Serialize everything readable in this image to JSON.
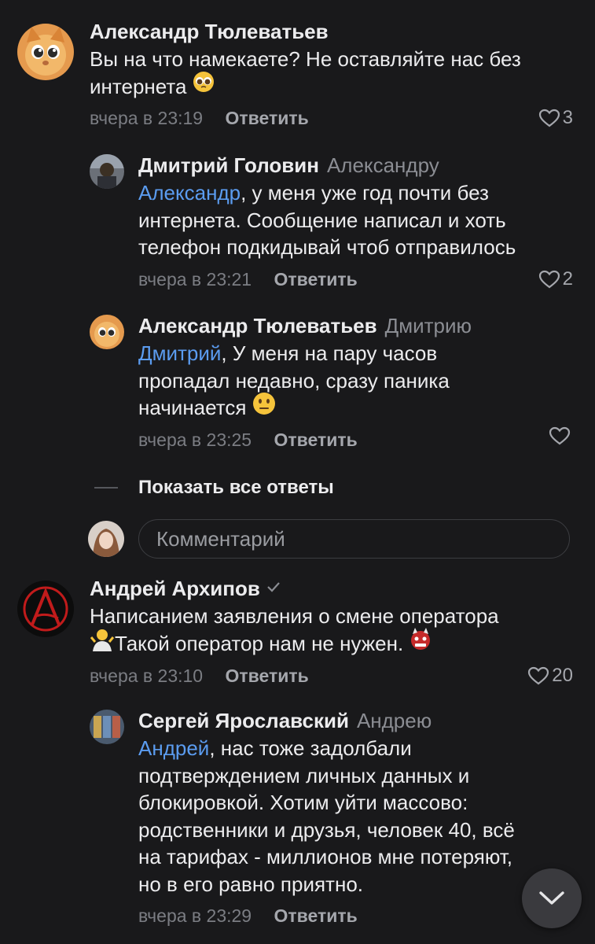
{
  "comments": [
    {
      "author": "Александр Тюлеватьев",
      "reply_to": "",
      "mention": "",
      "lines": [
        "Вы на что намекаете? Не оставляйте нас без",
        "интернета"
      ],
      "emoji": "pleading-face",
      "time": "вчера в 23:19",
      "reply_label": "Ответить",
      "likes": "3"
    },
    {
      "author": "Дмитрий Головин",
      "reply_to": "Александру",
      "mention": "Александр",
      "lines": [
        ", у меня уже год почти без",
        "интернета. Сообщение написал и хоть",
        "телефон подкидывай чтоб отправилось"
      ],
      "time": "вчера в 23:21",
      "reply_label": "Ответить",
      "likes": "2"
    },
    {
      "author": "Александр Тюлеватьев",
      "reply_to": "Дмитрию",
      "mention": "Дмитрий",
      "lines": [
        ", У меня на пару часов",
        "пропадал недавно, сразу паника",
        "начинается"
      ],
      "emoji": "neutral-face",
      "time": "вчера в 23:25",
      "reply_label": "Ответить",
      "likes": ""
    },
    {
      "author": "Андрей Архипов",
      "reply_to": "",
      "mention": "",
      "verified": true,
      "lines": [
        "Написанием заявления о смене оператора",
        "Такой оператор нам не нужен."
      ],
      "emoji": "ogre",
      "emoji_start": "person-shrugging",
      "time": "вчера в 23:10",
      "reply_label": "Ответить",
      "likes": "20"
    },
    {
      "author": "Сергей Ярославский",
      "reply_to": "Андрею",
      "mention": "Андрей",
      "lines": [
        ", нас тоже задолбали",
        "подтверждением личных данных и",
        "блокировкой. Хотим уйти массово:",
        "родственники и друзья, человек 40, всё",
        "на тарифах - миллионов мне потеряют,",
        "но в его равно приятно."
      ],
      "time": "вчера в 23:29",
      "reply_label": "Ответить",
      "likes": ""
    }
  ],
  "show_all_replies": "Показать все ответы",
  "comment_input": {
    "placeholder": "Комментарий"
  },
  "colors": {
    "background": "#19191b",
    "mention": "#5b9cf0",
    "muted": "#7b7d83"
  }
}
